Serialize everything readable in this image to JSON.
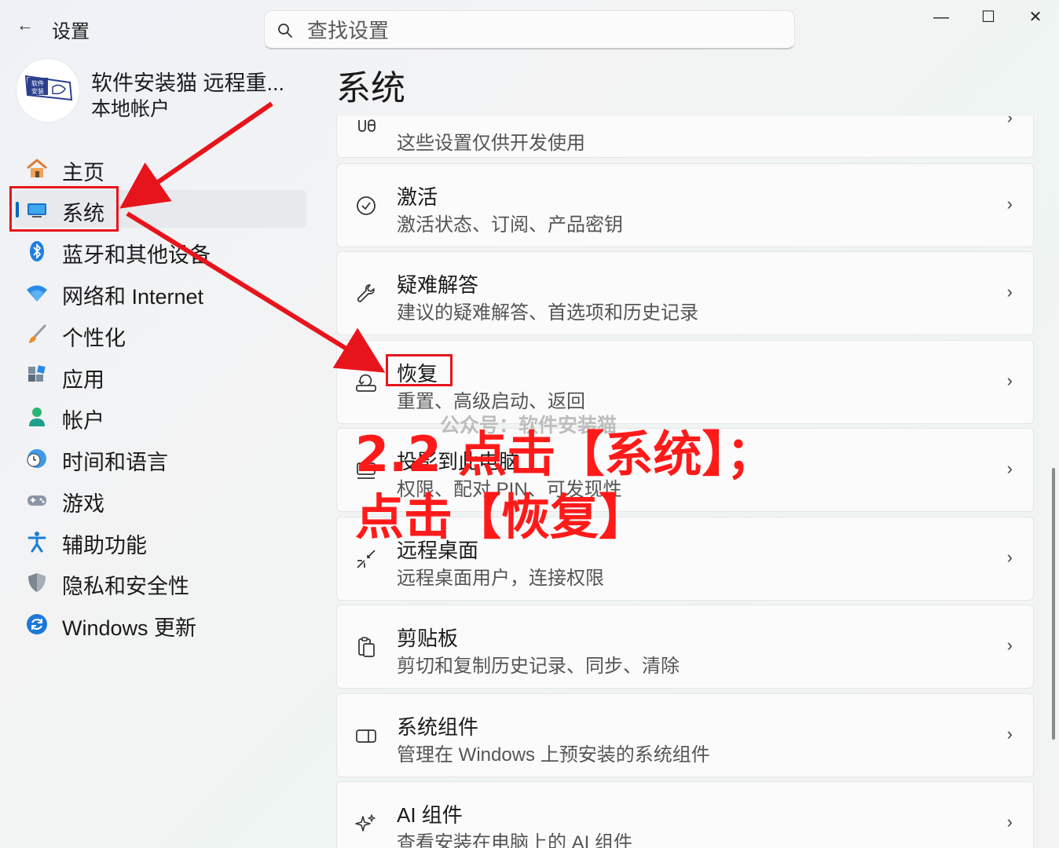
{
  "window": {
    "title": "设置",
    "back_glyph": "←",
    "minimize_glyph": "—",
    "maximize_glyph": "☐",
    "close_glyph": "✕"
  },
  "search": {
    "placeholder": "查找设置"
  },
  "account": {
    "name": "软件安装猫 远程重...",
    "type": "本地帐户",
    "avatar_text": "软件安装"
  },
  "sidebar": {
    "items": [
      {
        "label": "主页",
        "icon": "home-icon"
      },
      {
        "label": "系统",
        "icon": "system-icon",
        "selected": true
      },
      {
        "label": "蓝牙和其他设备",
        "icon": "bluetooth-icon"
      },
      {
        "label": "网络和 Internet",
        "icon": "wifi-icon"
      },
      {
        "label": "个性化",
        "icon": "brush-icon"
      },
      {
        "label": "应用",
        "icon": "apps-icon"
      },
      {
        "label": "帐户",
        "icon": "account-icon"
      },
      {
        "label": "时间和语言",
        "icon": "globe-clock-icon"
      },
      {
        "label": "游戏",
        "icon": "gamepad-icon"
      },
      {
        "label": "辅助功能",
        "icon": "accessibility-icon"
      },
      {
        "label": "隐私和安全性",
        "icon": "shield-icon"
      },
      {
        "label": "Windows 更新",
        "icon": "update-icon"
      }
    ]
  },
  "page": {
    "title": "系统"
  },
  "cards": [
    {
      "title": "",
      "subtitle": "这些设置仅供开发使用",
      "icon": "developer-icon"
    },
    {
      "title": "激活",
      "subtitle": "激活状态、订阅、产品密钥",
      "icon": "check-circle-icon"
    },
    {
      "title": "疑难解答",
      "subtitle": "建议的疑难解答、首选项和历史记录",
      "icon": "wrench-icon"
    },
    {
      "title": "恢复",
      "subtitle": "重置、高级启动、返回",
      "icon": "recovery-icon"
    },
    {
      "title": "投影到此电脑",
      "subtitle": "权限、配对 PIN、可发现性",
      "icon": "projector-icon"
    },
    {
      "title": "远程桌面",
      "subtitle": "远程桌面用户，连接权限",
      "icon": "remote-desktop-icon"
    },
    {
      "title": "剪贴板",
      "subtitle": "剪切和复制历史记录、同步、清除",
      "icon": "clipboard-icon"
    },
    {
      "title": "系统组件",
      "subtitle": "管理在 Windows 上预安装的系统组件",
      "icon": "components-icon"
    },
    {
      "title": "AI 组件",
      "subtitle": "查看安装在电脑上的 AI 组件",
      "icon": "sparkle-icon"
    }
  ],
  "chevron": "›",
  "annotation": {
    "line1": "2.2 点击【系统】；",
    "line2": "点击【恢复】",
    "watermark": "公众号：软件安装猫",
    "color": "#ff1a1a"
  }
}
